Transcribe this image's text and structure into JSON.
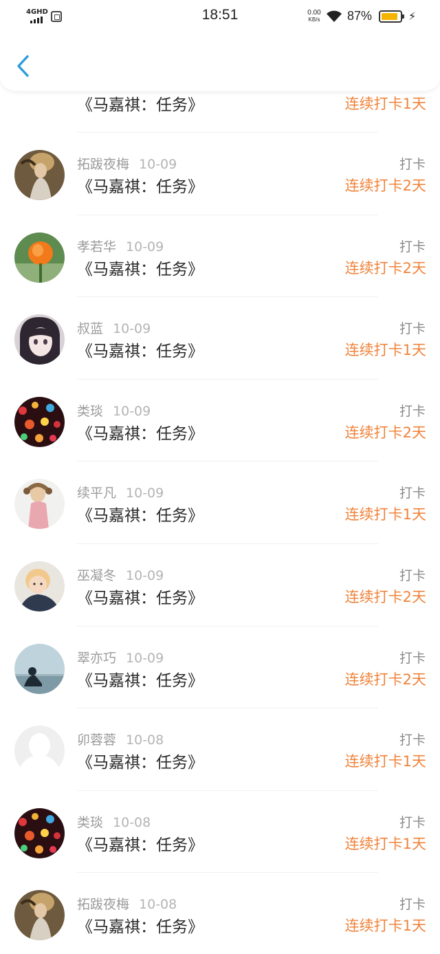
{
  "status_bar": {
    "network": "4GHD",
    "time": "18:51",
    "speed_value": "0.00",
    "speed_unit": "KB/s",
    "battery_percent": "87%",
    "battery_level": 0.87,
    "battery_color": "#f5b400"
  },
  "nav": {
    "back_icon": "chevron-left-icon",
    "accent_color": "#2d9cdb"
  },
  "colors": {
    "streak": "#f0833a",
    "meta": "#9b9b9b"
  },
  "list": {
    "rows": [
      {
        "name": "",
        "date": "",
        "title": "《马嘉祺：任务》",
        "action": "",
        "streak": "连续打卡1天",
        "avatar": "default-avatar-icon"
      },
      {
        "name": "拓跋夜梅",
        "date": "10-09",
        "title": "《马嘉祺：任务》",
        "action": "打卡",
        "streak": "连续打卡2天",
        "avatar": "portrait-photo"
      },
      {
        "name": "孝若华",
        "date": "10-09",
        "title": "《马嘉祺：任务》",
        "action": "打卡",
        "streak": "连续打卡2天",
        "avatar": "flower-photo"
      },
      {
        "name": "叔蓝",
        "date": "10-09",
        "title": "《马嘉祺：任务》",
        "action": "打卡",
        "streak": "连续打卡1天",
        "avatar": "anime-girl-photo"
      },
      {
        "name": "类琰",
        "date": "10-09",
        "title": "《马嘉祺：任务》",
        "action": "打卡",
        "streak": "连续打卡2天",
        "avatar": "bokeh-lights-photo"
      },
      {
        "name": "续平凡",
        "date": "10-09",
        "title": "《马嘉祺：任务》",
        "action": "打卡",
        "streak": "连续打卡1天",
        "avatar": "girl-photo"
      },
      {
        "name": "巫凝冬",
        "date": "10-09",
        "title": "《马嘉祺：任务》",
        "action": "打卡",
        "streak": "连续打卡2天",
        "avatar": "child-photo"
      },
      {
        "name": "翠亦巧",
        "date": "10-09",
        "title": "《马嘉祺：任务》",
        "action": "打卡",
        "streak": "连续打卡2天",
        "avatar": "seaside-photo"
      },
      {
        "name": "卯蓉蓉",
        "date": "10-08",
        "title": "《马嘉祺：任务》",
        "action": "打卡",
        "streak": "连续打卡1天",
        "avatar": "default-avatar-icon"
      },
      {
        "name": "类琰",
        "date": "10-08",
        "title": "《马嘉祺：任务》",
        "action": "打卡",
        "streak": "连续打卡1天",
        "avatar": "bokeh-lights-photo"
      },
      {
        "name": "拓跋夜梅",
        "date": "10-08",
        "title": "《马嘉祺：任务》",
        "action": "打卡",
        "streak": "连续打卡1天",
        "avatar": "portrait-photo"
      }
    ]
  }
}
